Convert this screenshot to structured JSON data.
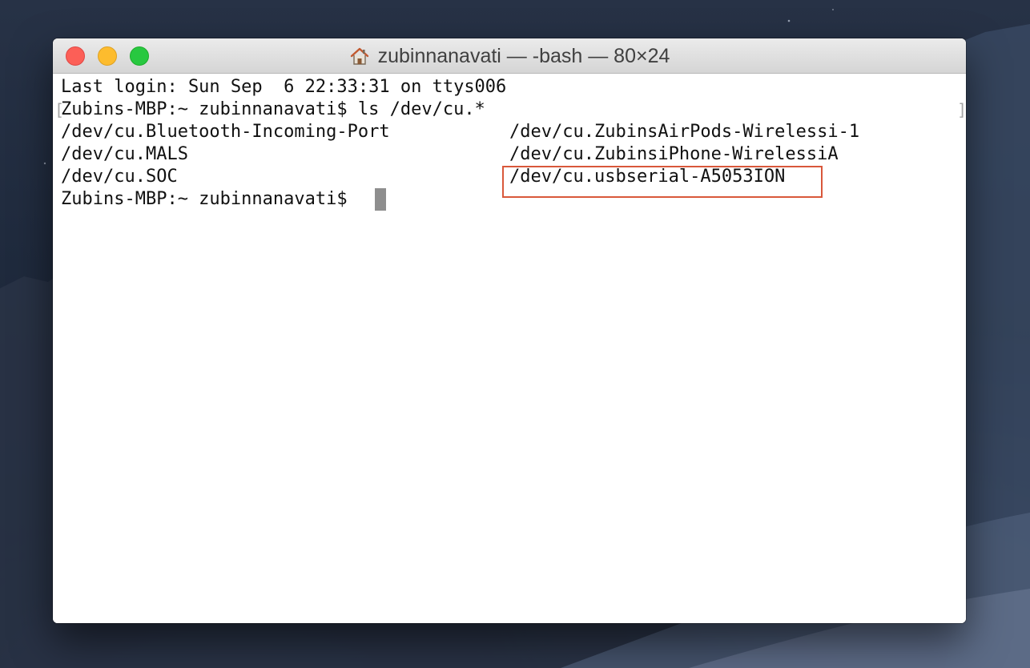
{
  "window": {
    "title": "zubinnanavati — -bash — 80×24",
    "title_icon": "home-icon",
    "controls": {
      "close_icon": "close-icon",
      "minimize_icon": "minimize-icon",
      "zoom_icon": "zoom-icon"
    }
  },
  "terminal": {
    "line_login": "Last login: Sun Sep  6 22:33:31 on ttys006",
    "line_command": "Zubins-MBP:~ zubinnanavati$ ls /dev/cu.*",
    "listing": {
      "col1": [
        "/dev/cu.Bluetooth-Incoming-Port",
        "/dev/cu.MALS",
        "/dev/cu.SOC"
      ],
      "col2": [
        "/dev/cu.ZubinsAirPods-Wirelessi-1",
        "/dev/cu.ZubinsiPhone-WirelessiA",
        "/dev/cu.usbserial-A5053ION"
      ]
    },
    "prompt": "Zubins-MBP:~ zubinnanavati$",
    "highlighted_entry": "/dev/cu.usbserial-A5053ION"
  },
  "colors": {
    "highlight_box": "#d9583b",
    "cursor": "#8e8e8e",
    "text": "#111111"
  }
}
